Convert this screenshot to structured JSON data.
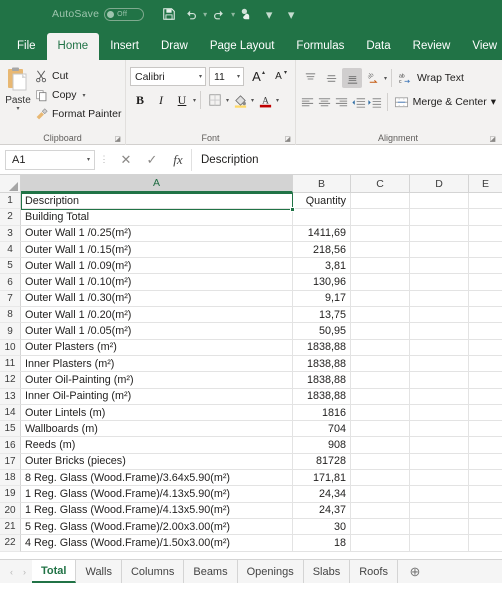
{
  "titlebar": {
    "autosave_label": "AutoSave",
    "autosave_state": "Off",
    "qat": [
      {
        "name": "save-icon",
        "label": "Save"
      },
      {
        "name": "undo-icon",
        "label": "Undo"
      },
      {
        "name": "redo-icon",
        "label": "Redo"
      },
      {
        "name": "touch-mouse-mode-icon",
        "label": "Touch/Mouse Mode"
      },
      {
        "name": "customize-qat-icon",
        "label": "Customize Quick Access Toolbar"
      }
    ]
  },
  "ribbon": {
    "tabs": [
      {
        "label": "File",
        "active": false
      },
      {
        "label": "Home",
        "active": true
      },
      {
        "label": "Insert",
        "active": false
      },
      {
        "label": "Draw",
        "active": false
      },
      {
        "label": "Page Layout",
        "active": false
      },
      {
        "label": "Formulas",
        "active": false
      },
      {
        "label": "Data",
        "active": false
      },
      {
        "label": "Review",
        "active": false
      },
      {
        "label": "View",
        "active": false
      }
    ],
    "clipboard": {
      "group_label": "Clipboard",
      "paste_label": "Paste",
      "cut_label": "Cut",
      "copy_label": "Copy",
      "format_painter_label": "Format Painter"
    },
    "font": {
      "group_label": "Font",
      "font_name": "Calibri",
      "font_size": "11",
      "bold_label": "B",
      "italic_label": "I",
      "underline_label": "U",
      "grow_font_label": "A",
      "shrink_font_label": "A"
    },
    "alignment": {
      "group_label": "Alignment",
      "wrap_text_label": "Wrap Text",
      "merge_center_label": "Merge & Center"
    }
  },
  "formulabar": {
    "namebox_value": "A1",
    "cancel_label": "✕",
    "enter_label": "✓",
    "fx_label": "fx",
    "formula_value": "Description"
  },
  "grid": {
    "columns": [
      "A",
      "B",
      "C",
      "D",
      "E"
    ],
    "active_column": "A",
    "rows": [
      {
        "n": "1",
        "a": "Description",
        "b": "Quantity"
      },
      {
        "n": "2",
        "a": "Building Total",
        "b": ""
      },
      {
        "n": "3",
        "a": "Outer Wall 1 /0.25(m²)",
        "b": "1411,69"
      },
      {
        "n": "4",
        "a": "Outer Wall 1 /0.15(m²)",
        "b": "218,56"
      },
      {
        "n": "5",
        "a": "Outer Wall 1 /0.09(m²)",
        "b": "3,81"
      },
      {
        "n": "6",
        "a": "Outer Wall 1 /0.10(m²)",
        "b": "130,96"
      },
      {
        "n": "7",
        "a": "Outer Wall 1 /0.30(m²)",
        "b": "9,17"
      },
      {
        "n": "8",
        "a": "Outer Wall 1 /0.20(m²)",
        "b": "13,75"
      },
      {
        "n": "9",
        "a": "Outer Wall 1 /0.05(m²)",
        "b": "50,95"
      },
      {
        "n": "10",
        "a": "Outer Plasters (m²)",
        "b": "1838,88"
      },
      {
        "n": "11",
        "a": "Inner Plasters (m²)",
        "b": "1838,88"
      },
      {
        "n": "12",
        "a": "Outer Oil-Painting (m²)",
        "b": "1838,88"
      },
      {
        "n": "13",
        "a": "Inner Oil-Painting (m²)",
        "b": "1838,88"
      },
      {
        "n": "14",
        "a": "Outer Lintels (m)",
        "b": "1816"
      },
      {
        "n": "15",
        "a": "Wallboards (m)",
        "b": "704"
      },
      {
        "n": "16",
        "a": "Reeds (m)",
        "b": "908"
      },
      {
        "n": "17",
        "a": "Outer Bricks (pieces)",
        "b": "81728"
      },
      {
        "n": "18",
        "a": "8 Reg. Glass (Wood.Frame)/3.64x5.90(m²)",
        "b": "171,81"
      },
      {
        "n": "19",
        "a": "1 Reg. Glass (Wood.Frame)/4.13x5.90(m²)",
        "b": "24,34"
      },
      {
        "n": "20",
        "a": "1 Reg. Glass (Wood.Frame)/4.13x5.90(m²)",
        "b": "24,37"
      },
      {
        "n": "21",
        "a": "5 Reg. Glass (Wood.Frame)/2.00x3.00(m²)",
        "b": "30"
      },
      {
        "n": "22",
        "a": "4 Reg. Glass (Wood.Frame)/1.50x3.00(m²)",
        "b": "18"
      }
    ]
  },
  "sheetbar": {
    "prev_label": "‹",
    "next_label": "›",
    "tabs": [
      {
        "label": "Total",
        "active": true
      },
      {
        "label": "Walls",
        "active": false
      },
      {
        "label": "Columns",
        "active": false
      },
      {
        "label": "Beams",
        "active": false
      },
      {
        "label": "Openings",
        "active": false
      },
      {
        "label": "Slabs",
        "active": false
      },
      {
        "label": "Roofs",
        "active": false
      }
    ],
    "add_sheet_label": "⊕"
  },
  "colors": {
    "brand_green": "#217346",
    "ribbon_bg": "#f3f2f1",
    "grid_line": "#e3e3e3"
  }
}
